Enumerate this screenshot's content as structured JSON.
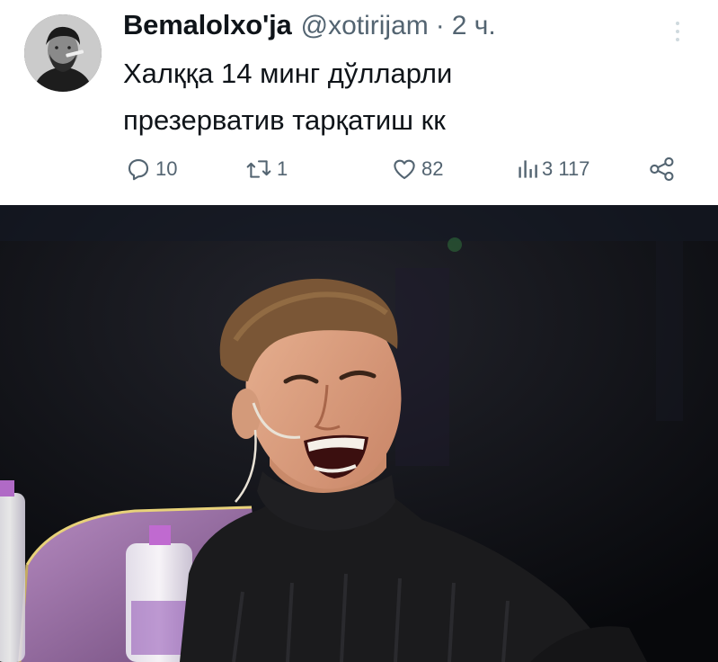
{
  "tweet": {
    "display_name": "Bemalolxo'ja",
    "handle": "@xotirijam",
    "separator": "·",
    "time": "2 ч.",
    "text_lines": [
      "Халққа 14 минг дўлларли",
      "презерватив тарқатиш кк"
    ],
    "actions": {
      "replies": "10",
      "retweets": "1",
      "likes": "82",
      "views": "3 117"
    }
  },
  "colors": {
    "text_primary": "#0f1419",
    "text_secondary": "#536471",
    "background": "#ffffff"
  },
  "icons": [
    "reply-icon",
    "retweet-icon",
    "like-icon",
    "views-icon",
    "share-icon",
    "more-options-icon"
  ]
}
